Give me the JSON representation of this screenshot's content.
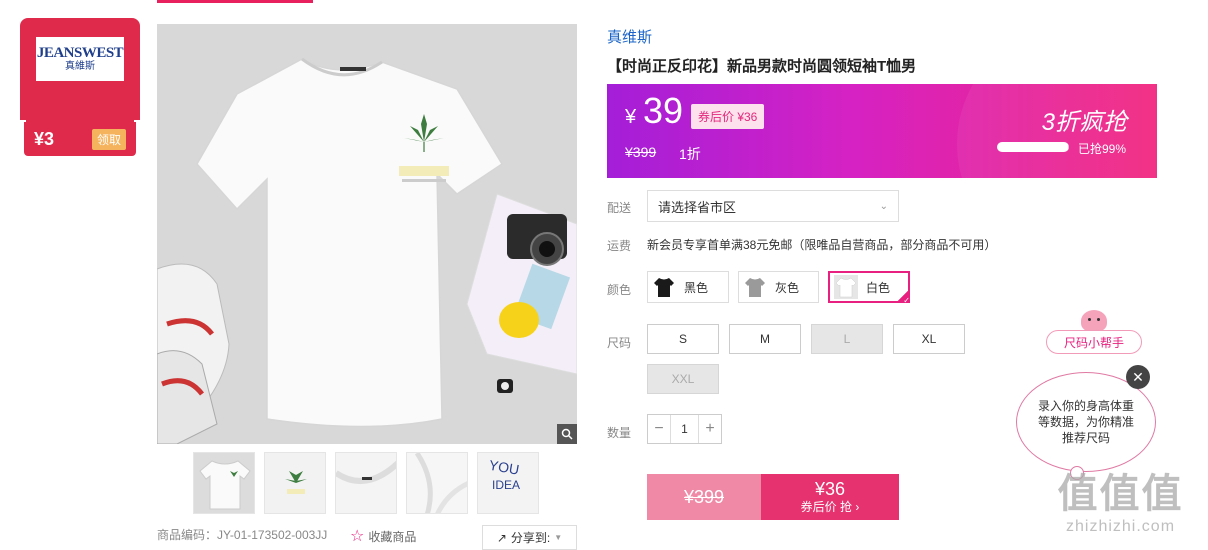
{
  "coupon": {
    "brand_en": "JEANSWEST",
    "brand_cn": "真維斯",
    "amount": "¥3",
    "claim_label": "领取"
  },
  "product": {
    "brand": "真维斯",
    "title": "【时尚正反印花】新品男款时尚圆领短袖T恤男",
    "sku_text": "商品编码：JY-01-173502-003JJ",
    "favorite_label": "收藏商品",
    "share_label": "分享到:"
  },
  "price": {
    "currency": "¥",
    "current": "39",
    "after_coupon": "券后价 ¥36",
    "original": "¥399",
    "discount": "1折",
    "promo": "3折疯抢",
    "sold_text": "已抢99%",
    "sold_fraction": 0.99
  },
  "delivery": {
    "label": "配送",
    "placeholder": "请选择省市区"
  },
  "shipping": {
    "label": "运费",
    "text": "新会员专享首单满38元免邮（限唯品自营商品，部分商品不可用）"
  },
  "color": {
    "label": "颜色",
    "options": [
      {
        "name": "黑色",
        "swatch": "#1a1a1a"
      },
      {
        "name": "灰色",
        "swatch": "#9a9a9a"
      },
      {
        "name": "白色",
        "swatch": "#ffffff"
      }
    ],
    "selected": "白色"
  },
  "size": {
    "label": "尺码",
    "options": [
      {
        "name": "S",
        "available": true
      },
      {
        "name": "M",
        "available": true
      },
      {
        "name": "L",
        "available": false
      },
      {
        "name": "XL",
        "available": true
      },
      {
        "name": "XXL",
        "available": false
      }
    ]
  },
  "quantity": {
    "label": "数量",
    "value": "1"
  },
  "buy": {
    "original_price": "¥399",
    "price": "¥36",
    "label": "券后价 抢"
  },
  "size_helper": {
    "title": "尺码小帮手",
    "text": "录入你的身高体重等数据，为你精准推荐尺码"
  },
  "watermark": {
    "text": "值值值",
    "url": "zhizhizhi.com"
  },
  "colors": {
    "accent": "#e8207f",
    "link": "#1a64c9",
    "coupon_red": "#e02a4c"
  }
}
